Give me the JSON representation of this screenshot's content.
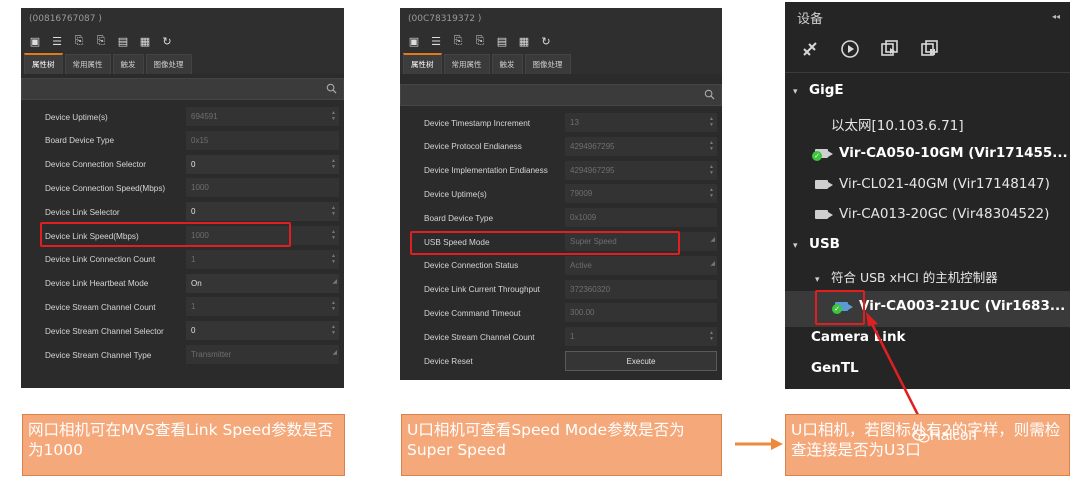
{
  "panel1": {
    "title": "(00816767087 )",
    "tabs": [
      "属性树",
      "常用属性",
      "触发",
      "图像处理"
    ],
    "rows": [
      {
        "name": "Device Uptime(s)",
        "value": "694591",
        "editable": false,
        "ctrl": "spin"
      },
      {
        "name": "Board Device Type",
        "value": "0x15",
        "editable": false,
        "ctrl": "none"
      },
      {
        "name": "Device Connection Selector",
        "value": "0",
        "editable": true,
        "ctrl": "spin"
      },
      {
        "name": "Device Connection Speed(Mbps)",
        "value": "1000",
        "editable": false,
        "ctrl": "none"
      },
      {
        "name": "Device Link Selector",
        "value": "0",
        "editable": true,
        "ctrl": "spin"
      },
      {
        "name": "Device Link Speed(Mbps)",
        "value": "1000",
        "editable": false,
        "ctrl": "spin"
      },
      {
        "name": "Device Link Connection Count",
        "value": "1",
        "editable": false,
        "ctrl": "spin"
      },
      {
        "name": "Device Link Heartbeat Mode",
        "value": "On",
        "editable": true,
        "ctrl": "corner"
      },
      {
        "name": "Device Stream Channel Count",
        "value": "1",
        "editable": false,
        "ctrl": "spin"
      },
      {
        "name": "Device Stream Channel Selector",
        "value": "0",
        "editable": true,
        "ctrl": "spin"
      },
      {
        "name": "Device Stream Channel Type",
        "value": "Transmitter",
        "editable": false,
        "ctrl": "corner"
      }
    ]
  },
  "panel2": {
    "title": "(00C78319372 )",
    "tabs": [
      "属性树",
      "常用属性",
      "触发",
      "图像处理"
    ],
    "rows": [
      {
        "name": "Device Timestamp Increment",
        "value": "13",
        "editable": false,
        "ctrl": "spin"
      },
      {
        "name": "Device Protocol Endianess",
        "value": "4294967295",
        "editable": false,
        "ctrl": "spin"
      },
      {
        "name": "Device Implementation Endianess",
        "value": "4294967295",
        "editable": false,
        "ctrl": "spin"
      },
      {
        "name": "Device Uptime(s)",
        "value": "79009",
        "editable": false,
        "ctrl": "spin"
      },
      {
        "name": "Board Device Type",
        "value": "0x1009",
        "editable": false,
        "ctrl": "none"
      },
      {
        "name": "USB Speed Mode",
        "value": "Super Speed",
        "editable": false,
        "ctrl": "corner"
      },
      {
        "name": "Device Connection Status",
        "value": "Active",
        "editable": false,
        "ctrl": "corner"
      },
      {
        "name": "Device Link Current Throughput",
        "value": "372360320",
        "editable": false,
        "ctrl": "none"
      },
      {
        "name": "Device Command Timeout",
        "value": "300.00",
        "editable": false,
        "ctrl": "none"
      },
      {
        "name": "Device Stream Channel Count",
        "value": "1",
        "editable": false,
        "ctrl": "spin"
      },
      {
        "name": "Device Reset",
        "value": "Execute",
        "editable": true,
        "ctrl": "button"
      }
    ]
  },
  "panel3": {
    "title": "设备",
    "collapse": "◂◂",
    "tree": {
      "gige": "GigE",
      "network": "以太网[10.103.6.71]",
      "cam1": "Vir-CA050-10GM (Vir171455...",
      "cam2": "Vir-CL021-40GM (Vir17148147)",
      "cam3": "Vir-CA013-20GC (Vir48304522)",
      "usb": "USB",
      "controller": "符合 USB xHCI 的主机控制器",
      "cam4": "Vir-CA003-21UC (Vir1683...",
      "cameralink": "Camera Link",
      "gentl": "GenTL"
    }
  },
  "notes": {
    "note1": "网口相机可在MVS查看Link Speed参数是否为1000",
    "note2": "U口相机可查看Speed Mode参数是否为Super Speed",
    "note3": "U口相机，若图标处有2的字样，则需检查连接是否为U3口"
  },
  "watermark": "Halcon",
  "colors": {
    "accent": "#e07a1a",
    "highlight": "#e02020",
    "note_bg": "#f5a87a",
    "ok": "#3ec43e"
  }
}
